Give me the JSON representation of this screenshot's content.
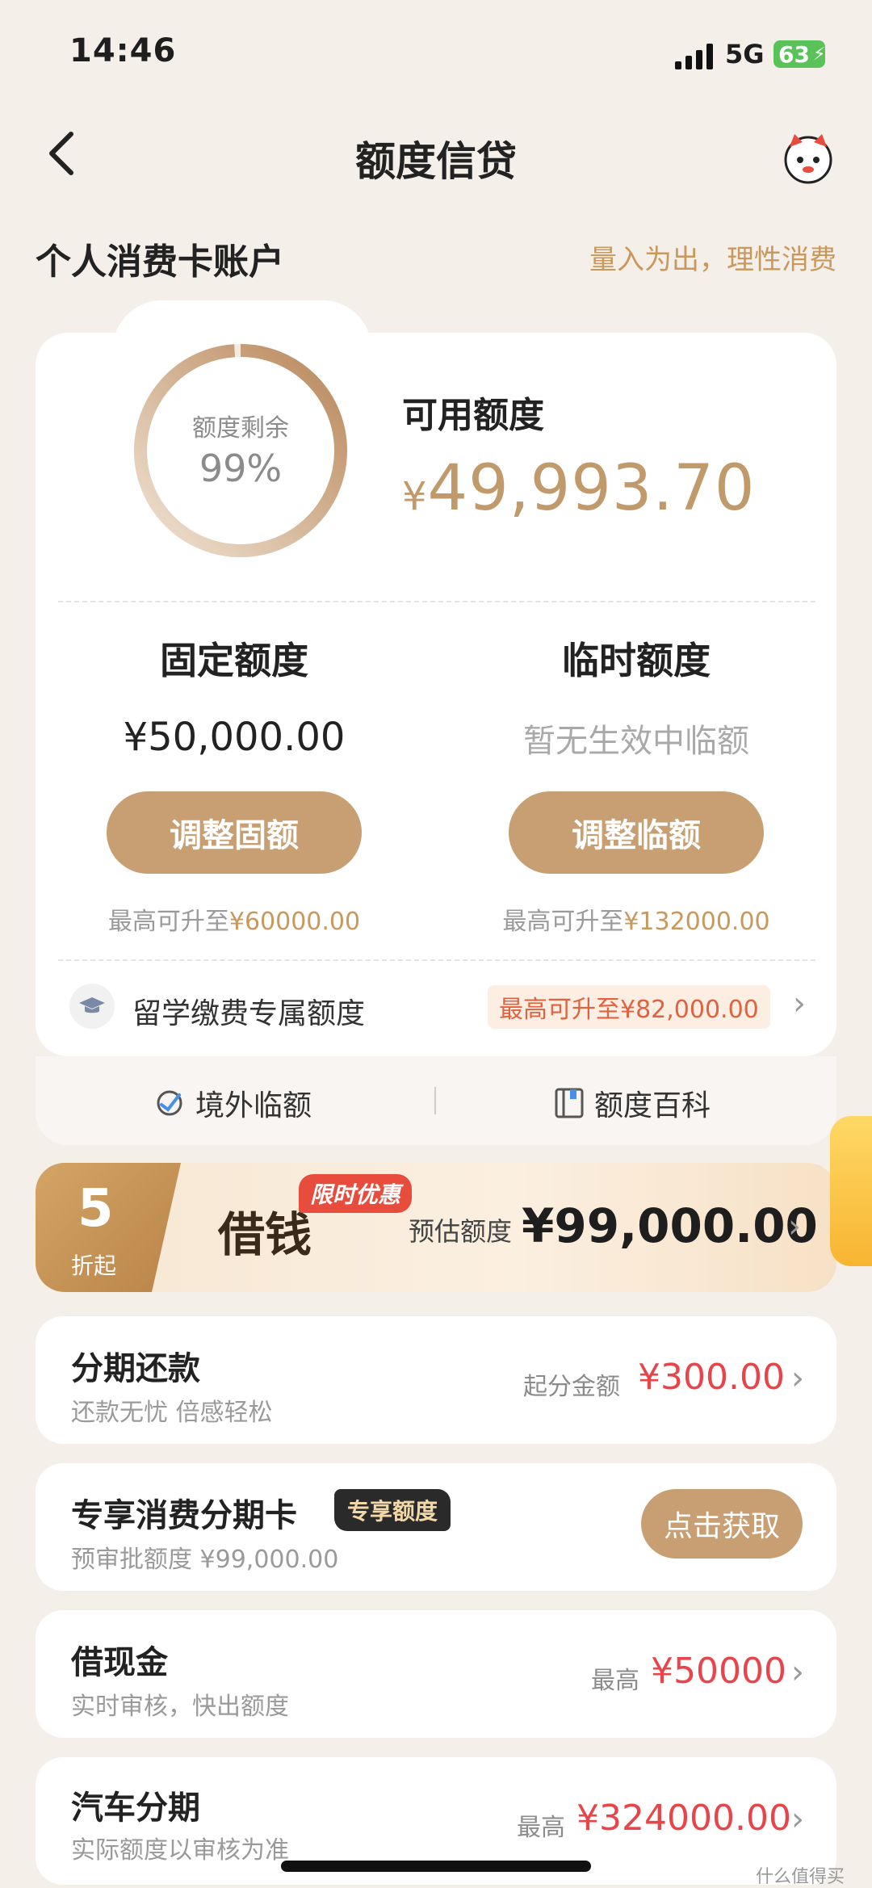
{
  "status_bar": {
    "time": "14:46",
    "network": "5G",
    "battery": "63"
  },
  "nav": {
    "title": "额度信贷"
  },
  "account": {
    "title": "个人消费卡账户",
    "slogan": "量入为出，理性消费"
  },
  "credit": {
    "remaining_label": "额度剩余",
    "remaining_percent": "99%",
    "remaining_fraction": 0.99,
    "available_label": "可用额度",
    "available_currency": "¥",
    "available_amount": "49,993.70",
    "fixed": {
      "title": "固定额度",
      "amount": "¥50,000.00",
      "button": "调整固额",
      "max_prefix": "最高可升至",
      "max_value": "¥60000.00"
    },
    "temporary": {
      "title": "临时额度",
      "status": "暂无生效中临额",
      "button": "调整临额",
      "max_prefix": "最高可升至",
      "max_value": "¥132000.00"
    },
    "study_abroad": {
      "label": "留学缴费专属额度",
      "badge": "最高可升至¥82,000.00"
    },
    "links": {
      "overseas": "境外临额",
      "wiki": "额度百科"
    }
  },
  "loan_banner": {
    "discount_number": "5",
    "discount_suffix": "折起",
    "title": "借钱",
    "tag": "限时优惠",
    "estimate_label": "预估额度",
    "estimate_amount": "¥99,000.00"
  },
  "items": [
    {
      "title": "分期还款",
      "subtitle": "还款无忧 倍感轻松",
      "right_label": "起分金额",
      "right_value": "¥300.00"
    },
    {
      "title": "专享消费分期卡",
      "tag": "专享额度",
      "subtitle": "预审批额度 ¥99,000.00",
      "button": "点击获取"
    },
    {
      "title": "借现金",
      "subtitle": "实时审核，快出额度",
      "right_label": "最高",
      "right_value": "¥50000"
    },
    {
      "title": "汽车分期",
      "subtitle": "实际额度以审核为准",
      "right_label": "最高",
      "right_value": "¥324000.00"
    }
  ],
  "watermark": "什么值得买",
  "colors": {
    "gold": "#c79f73",
    "accent_text": "#c9985d",
    "price_red": "#e8454a",
    "page_bg": "#f4efe9"
  }
}
